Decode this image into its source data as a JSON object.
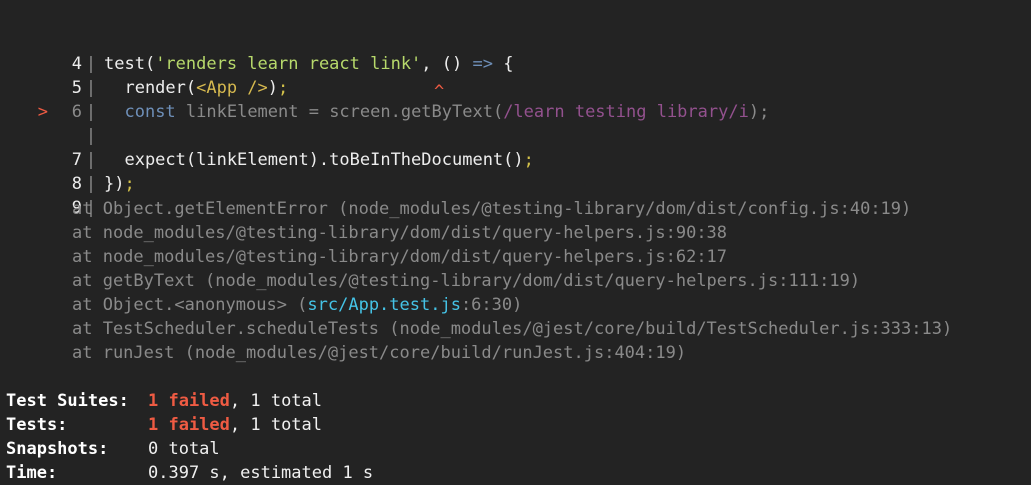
{
  "code_frame": {
    "gutter_marker": ">",
    "pipe": "|",
    "lines": [
      {
        "num": "4",
        "text": "test('renders learn react link', () => {"
      },
      {
        "num": "5",
        "text": "render(<App />);"
      },
      {
        "num": "6",
        "text": "const linkElement = screen.getByText(/learn testing library/i);",
        "highlight": true
      },
      {
        "num": "",
        "text": ""
      },
      {
        "num": "7",
        "text": "expect(linkElement).toBeInTheDocument();"
      },
      {
        "num": "8",
        "text": "});"
      },
      {
        "num": "9",
        "text": ""
      }
    ],
    "caret": "^"
  },
  "stack_trace": [
    {
      "text": "at Object.getElementError (node_modules/@testing-library/dom/dist/config.js:40:19)"
    },
    {
      "text": "at node_modules/@testing-library/dom/dist/query-helpers.js:90:38"
    },
    {
      "text": "at node_modules/@testing-library/dom/dist/query-helpers.js:62:17"
    },
    {
      "text": "at getByText (node_modules/@testing-library/dom/dist/query-helpers.js:111:19)"
    },
    {
      "prefix": "at Object.<anonymous> (",
      "link": "src/App.test.js",
      "suffix": ":6:30)"
    },
    {
      "text": "at TestScheduler.scheduleTests (node_modules/@jest/core/build/TestScheduler.js:333:13)"
    },
    {
      "text": "at runJest (node_modules/@jest/core/build/runJest.js:404:19)"
    }
  ],
  "summary": {
    "suites": {
      "label": "Test Suites:",
      "failed": "1 failed",
      "rest": ", 1 total"
    },
    "tests": {
      "label": "Tests:",
      "failed": "1 failed",
      "rest": ", 1 total"
    },
    "snapshots": {
      "label": "Snapshots:",
      "value": "0 total"
    },
    "time": {
      "label": "Time:",
      "value": "0.397 s, estimated 1 s"
    }
  },
  "colors": {
    "background": "#232323",
    "error_red": "#ef5b43",
    "link_cyan": "#45c3e6",
    "dim_gray": "#8a8a8a"
  }
}
